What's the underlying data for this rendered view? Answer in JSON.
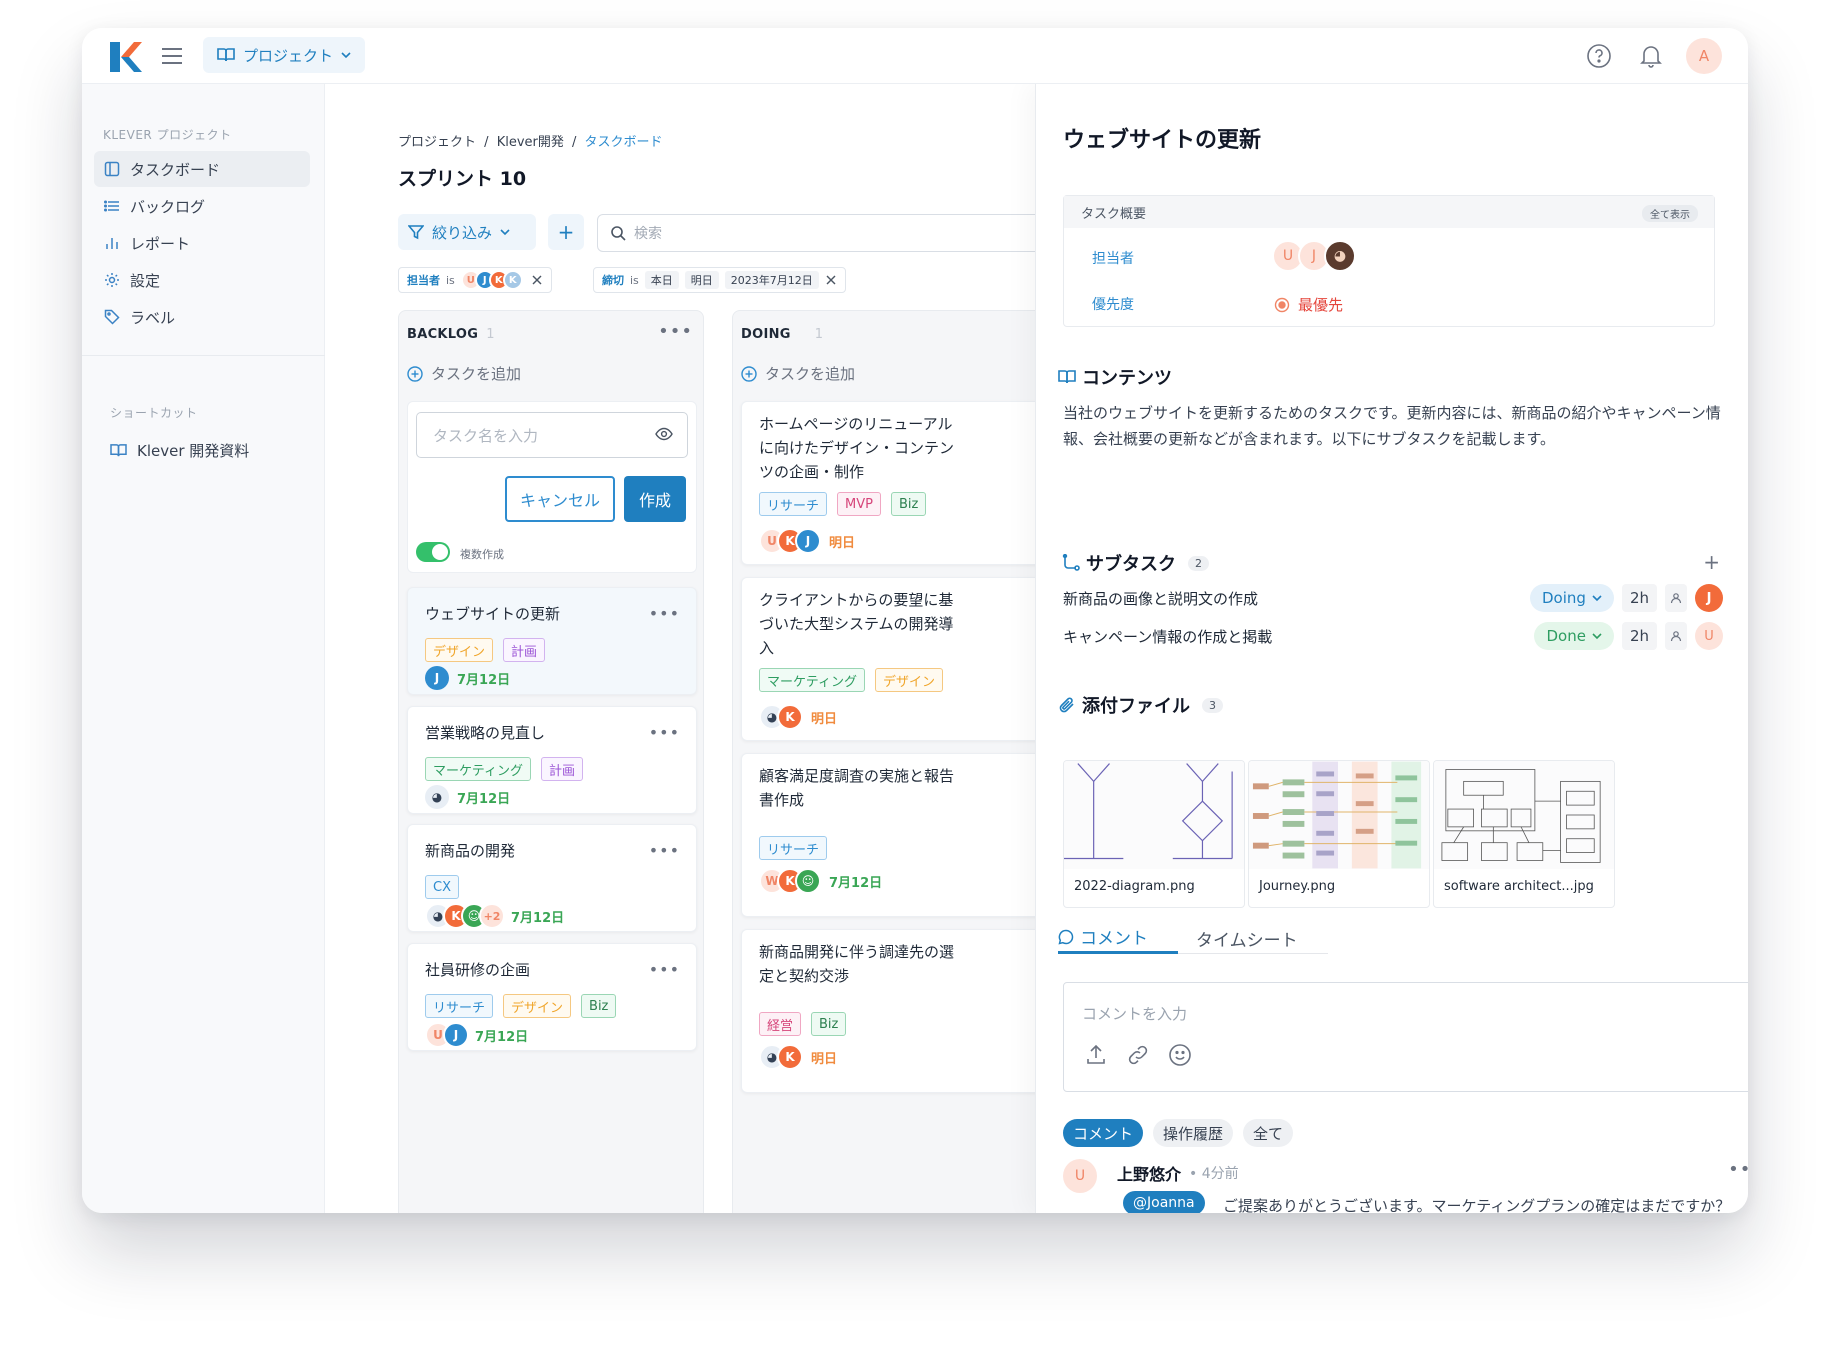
{
  "topbar": {
    "project_label": "プロジェクト",
    "avatar": "A"
  },
  "sidebar": {
    "section_title": "KLEVER プロジェクト",
    "items": [
      {
        "label": "タスクボード",
        "icon": "board-icon"
      },
      {
        "label": "バックログ",
        "icon": "list-icon"
      },
      {
        "label": "レポート",
        "icon": "bar-chart-icon"
      },
      {
        "label": "設定",
        "icon": "gear-icon"
      },
      {
        "label": "ラベル",
        "icon": "tag-icon"
      }
    ],
    "shortcut_title": "ショートカット",
    "shortcut_item": "Klever 開発資料"
  },
  "board": {
    "breadcrumb": {
      "p1": "プロジェクト",
      "sep": "/",
      "p2": "Klever開発",
      "p3": "タスクボード"
    },
    "title": "スプリント 10",
    "filter_label": "絞り込み",
    "add_label": "+",
    "search_placeholder": "検索",
    "chip1": {
      "field": "担当者",
      "op": "is"
    },
    "chip2": {
      "field": "締切",
      "op": "is",
      "v1": "本日",
      "v2": "明日",
      "v3": "2023年7月12日"
    },
    "backlog": {
      "name": "BACKLOG",
      "count": "1",
      "add": "タスクを追加",
      "input_placeholder": "タスク名を入力",
      "cancel": "キャンセル",
      "create": "作成",
      "toggle_label": "複数作成",
      "cards": [
        {
          "title": "ウェブサイトの更新",
          "tags": [
            "デザイン",
            "計画"
          ],
          "date": "7月12日"
        },
        {
          "title": "営業戦略の見直し",
          "tags": [
            "マーケティング",
            "計画"
          ],
          "date": "7月12日"
        },
        {
          "title": "新商品の開発",
          "tags": [
            "CX"
          ],
          "more": "+2",
          "date": "7月12日"
        },
        {
          "title": "社員研修の企画",
          "tags": [
            "リサーチ",
            "デザイン",
            "Biz"
          ],
          "date": "7月12日"
        }
      ]
    },
    "doing": {
      "name": "DOING",
      "count": "1",
      "add": "タスクを追加",
      "cards": [
        {
          "title": "ホームページのリニューアルに向けたデザイン・コンテンツの企画・制作",
          "tags": [
            "リサーチ",
            "MVP",
            "Biz"
          ],
          "date": "明日"
        },
        {
          "title": "クライアントからの要望に基づいた大型システムの開発導入",
          "tags": [
            "マーケティング",
            "デザイン"
          ],
          "date": "明日"
        },
        {
          "title": "顧客満足度調査の実施と報告書作成",
          "tags": [
            "リサーチ"
          ],
          "date": "7月12日"
        },
        {
          "title": "新商品開発に伴う調達先の選定と契約交渉",
          "tags": [
            "経営",
            "Biz"
          ],
          "date": "明日"
        }
      ]
    }
  },
  "detail": {
    "title": "ウェブサイトの更新",
    "summary_title": "タスク概要",
    "show_all": "全て表示",
    "assignee_label": "担当者",
    "priority_label": "優先度",
    "priority_value": "最優先",
    "content_title": "コンテンツ",
    "content_text": "当社のウェブサイトを更新するためのタスクです。更新内容には、新商品の紹介やキャンペーン情報、会社概要の更新などが含まれます。以下にサブタスクを記載します。",
    "subtask_title": "サブタスク",
    "subtask_count": "2",
    "subtasks": [
      {
        "name": "新商品の画像と説明文の作成",
        "status": "Doing",
        "hours": "2h",
        "avatar": "J"
      },
      {
        "name": "キャンペーン情報の作成と掲載",
        "status": "Done",
        "hours": "2h",
        "avatar": "U"
      }
    ],
    "attach_title": "添付ファイル",
    "attach_count": "3",
    "attachments": [
      "2022-diagram.png",
      "Journey.png",
      "software architect...jpg"
    ],
    "tab_comment": "コメント",
    "tab_timesheet": "タイムシート",
    "comment_placeholder": "コメントを入力",
    "filter_comment": "コメント",
    "filter_history": "操作履歴",
    "filter_all": "全て",
    "comment": {
      "avatar": "U",
      "author": "上野悠介",
      "time": "• 4分前",
      "mention": "@Joanna",
      "text": "ご提案ありがとうございます。マーケティングプランの確定はまだですか？"
    }
  },
  "colors": {
    "accent": "#1f7fbf",
    "success": "#34c06b",
    "danger": "#e5463c"
  }
}
